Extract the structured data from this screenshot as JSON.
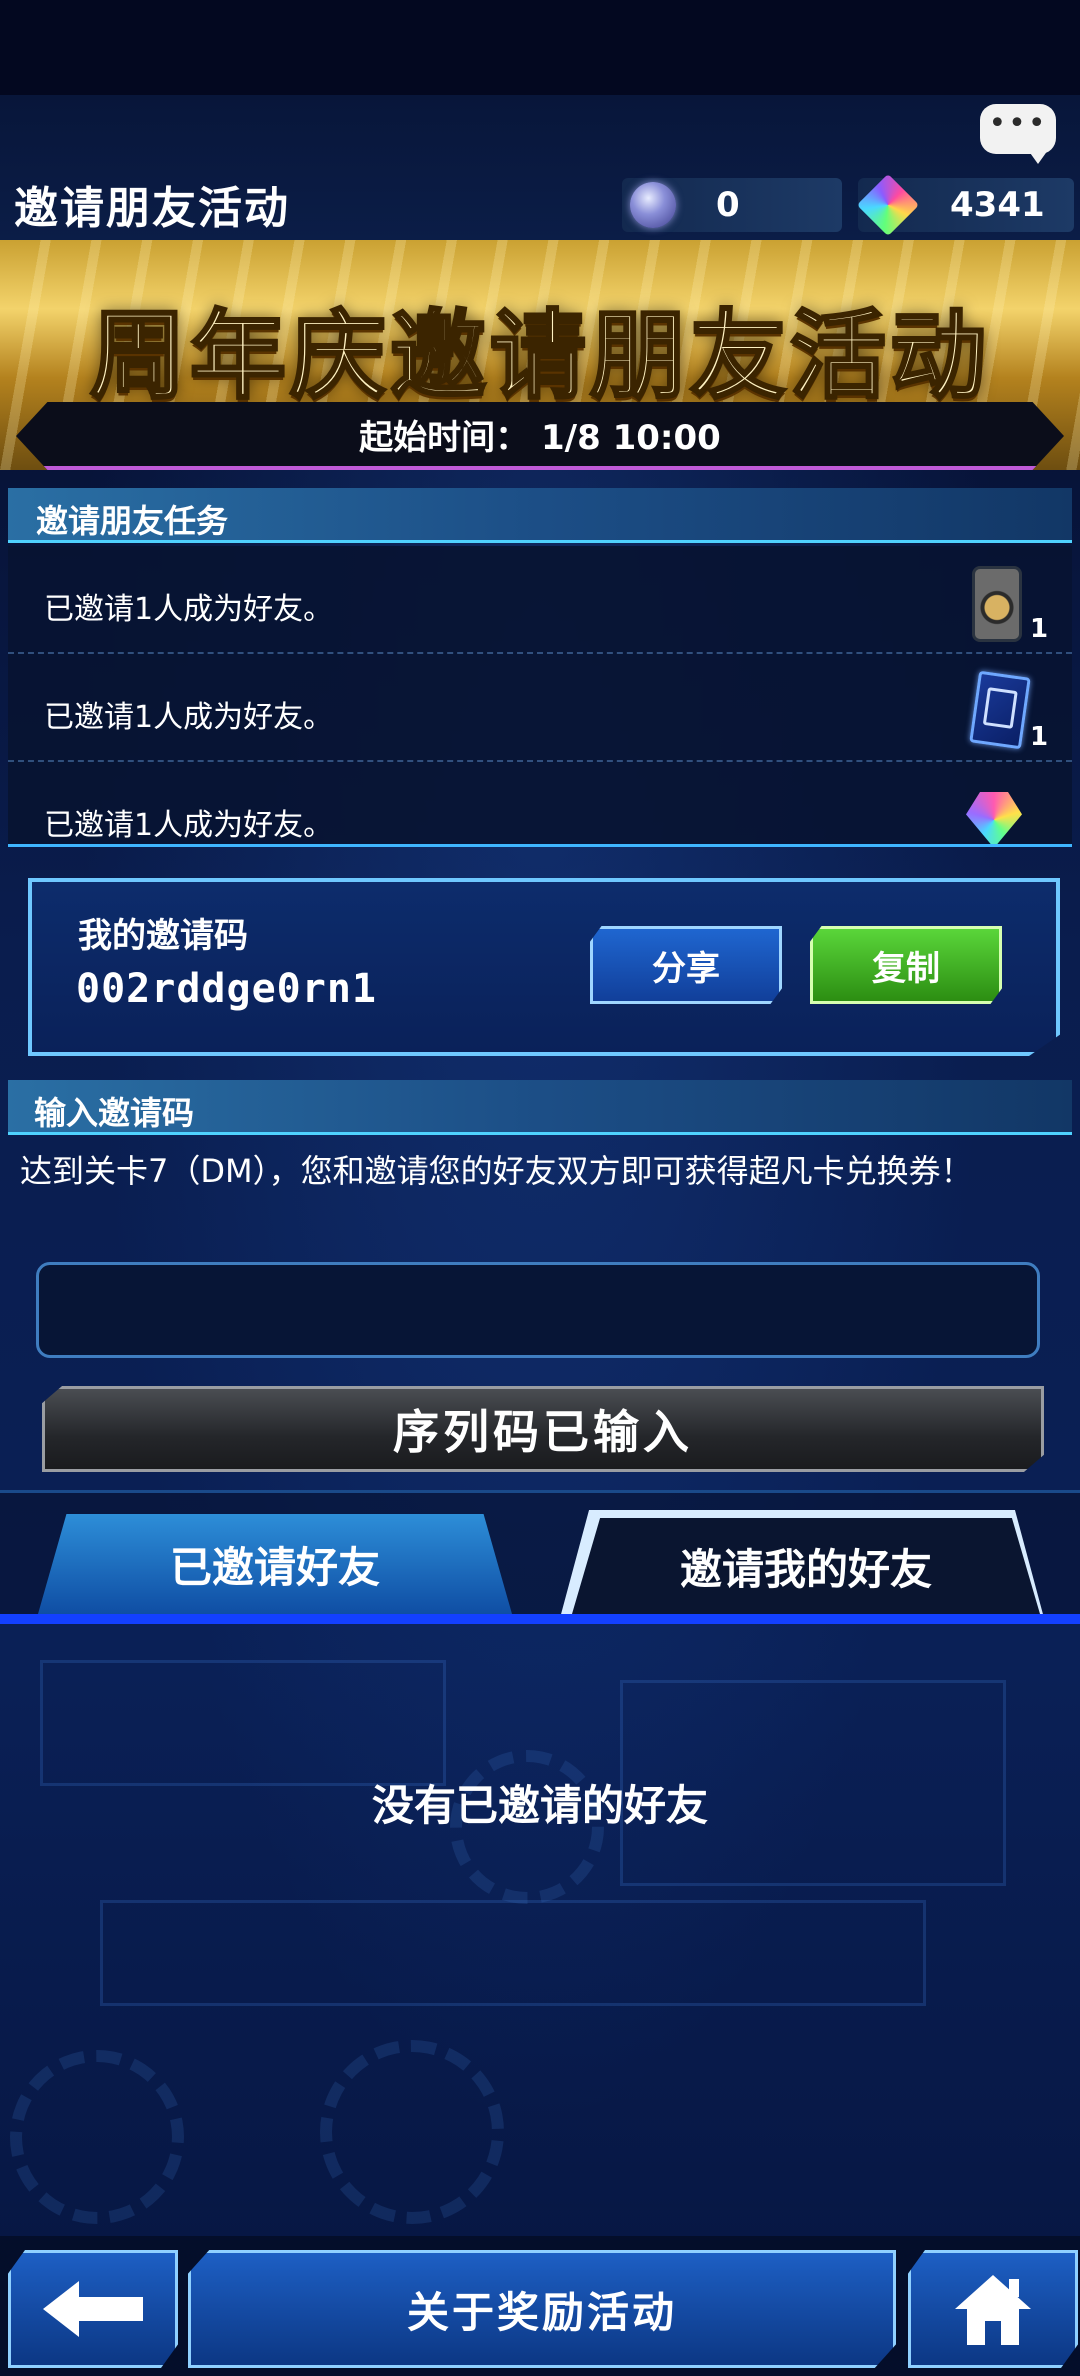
{
  "header": {
    "title": "邀请朋友活动",
    "orb_count": "0",
    "gem_count": "4341",
    "chat_icon": "chat-bubble-icon",
    "chat_glyph": "•••"
  },
  "banner": {
    "title": "周年庆邀请朋友活动",
    "start_time": "起始时间： 1/8 10:00"
  },
  "tasks": {
    "heading": "邀请朋友任务",
    "items": [
      {
        "text": "已邀请1人成为好友。",
        "reward_icon": "duel-disk-icon",
        "count": "1"
      },
      {
        "text": "已邀请1人成为好友。",
        "reward_icon": "card-pack-icon",
        "count": "1"
      },
      {
        "text": "已邀请1人成为好友。",
        "reward_icon": "gem-icon",
        "count": ""
      }
    ]
  },
  "my_code": {
    "label": "我的邀请码",
    "value": "002rddge0rn1",
    "share_label": "分享",
    "copy_label": "复制"
  },
  "enter_code": {
    "heading": "输入邀请码",
    "description": "达到关卡7（DM），您和邀请您的好友双方即可获得超凡卡兑换券！",
    "input_value": "",
    "input_placeholder": "",
    "submit_label": "序列码已输入"
  },
  "tabs": {
    "invited": "已邀请好友",
    "invited_me": "邀请我的好友",
    "active": "invited"
  },
  "list": {
    "empty_message": "没有已邀请的好友"
  },
  "bottom_nav": {
    "back_icon": "arrow-left-icon",
    "about_label": "关于奖励活动",
    "home_icon": "home-icon"
  },
  "colors": {
    "accent_blue": "#1f66d0",
    "accent_green": "#5ad63a",
    "tab_underline": "#1340ff",
    "gold": "#f3d36b"
  }
}
